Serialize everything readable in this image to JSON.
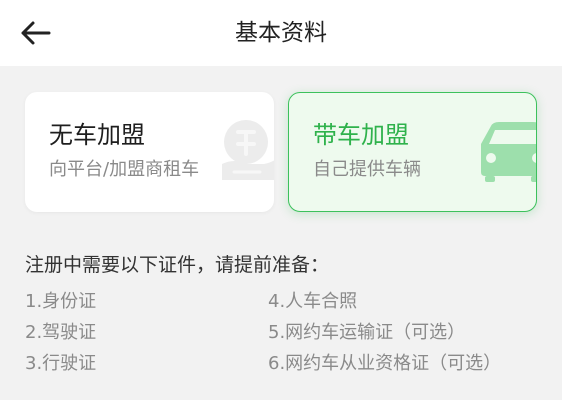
{
  "header": {
    "title": "基本资料",
    "back_icon": "arrow-left-icon"
  },
  "cards": [
    {
      "title": "无车加盟",
      "subtitle": "向平台/加盟商租车",
      "icon": "rent-coin-hand-icon",
      "selected": false
    },
    {
      "title": "带车加盟",
      "subtitle": "自己提供车辆",
      "icon": "car-icon",
      "selected": true
    }
  ],
  "requirements": {
    "notice": "注册中需要以下证件，请提前准备：",
    "items": [
      "1.身份证",
      "2.驾驶证",
      "3.行驶证",
      "4.人车合照",
      "5.网约车运输证（可选）",
      "6.网约车从业资格证（可选）"
    ]
  },
  "colors": {
    "accent": "#2fb24c",
    "selected_border": "#3cc15c",
    "selected_bg": "#eefaee",
    "page_bg": "#f2f2f2",
    "muted_text": "#8a8a8a"
  }
}
